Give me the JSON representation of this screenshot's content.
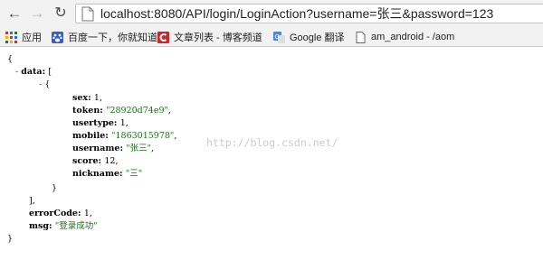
{
  "browser": {
    "back_icon": "arrow-left-icon",
    "forward_icon": "arrow-right-icon",
    "reload_icon": "reload-icon",
    "url": "localhost:8080/API/login/LoginAction?username=张三&password=123"
  },
  "bookmarks": [
    {
      "label": "应用",
      "icon": "apps-grid-icon"
    },
    {
      "label": "百度一下，你就知道",
      "icon": "baidu-paw-icon"
    },
    {
      "label": "文章列表 - 博客频道",
      "icon": "csdn-logo-icon"
    },
    {
      "label": "Google 翻译",
      "icon": "google-translate-icon"
    },
    {
      "label": "am_android - /aom",
      "icon": "page-icon"
    }
  ],
  "json_view": {
    "open_brace": "{",
    "close_brace": "}",
    "data_key": "data",
    "data_open": "[",
    "data_close": "],",
    "item_open": "{",
    "item_close": "}",
    "toggle": "-",
    "fields": [
      {
        "key": "sex",
        "value": "1",
        "type": "number"
      },
      {
        "key": "token",
        "value": "\"28920d74e9\"",
        "type": "string"
      },
      {
        "key": "usertype",
        "value": "1",
        "type": "number"
      },
      {
        "key": "mobile",
        "value": "\"1863015978\"",
        "type": "string"
      },
      {
        "key": "username",
        "value": "\"张三\"",
        "type": "string"
      },
      {
        "key": "score",
        "value": "12",
        "type": "number"
      },
      {
        "key": "nickname",
        "value": "\"三\"",
        "type": "string"
      }
    ],
    "error_code_key": "errorCode",
    "error_code_value": "1",
    "msg_key": "msg",
    "msg_value": "\"登录成功\""
  },
  "watermark": "http://blog.csdn.net/",
  "colors": {
    "string": "#1a6e1a",
    "chrome_bg": "#f2f2f2",
    "csdn_red": "#c9282d",
    "baidu_blue": "#2f5dd6",
    "google_blue": "#4a86e8"
  }
}
